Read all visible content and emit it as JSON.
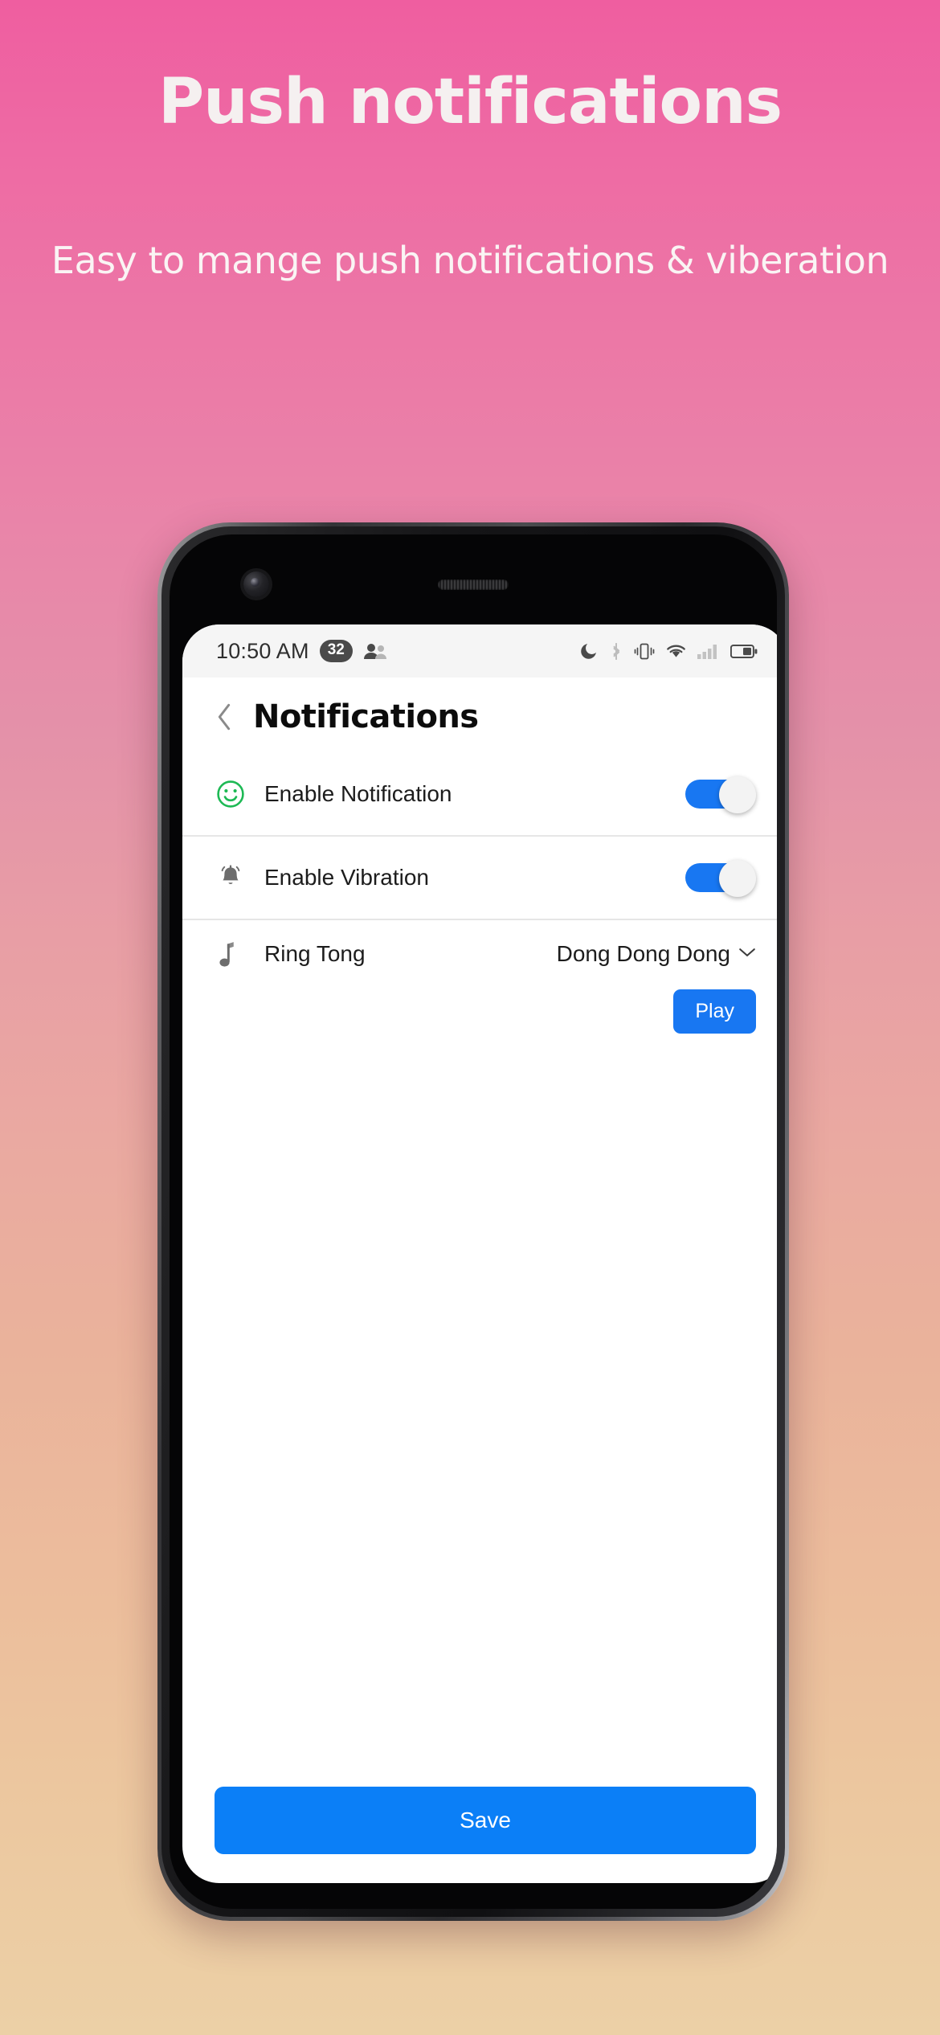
{
  "promo": {
    "title": "Push notifications",
    "subtitle": "Easy to mange push notifications & viberation"
  },
  "colors": {
    "accent_blue": "#1877f2",
    "save_blue": "#0b7ff7",
    "smiley_green": "#1db954",
    "bg_top": "#ef5ea0",
    "bg_bottom": "#ecd0a6",
    "volume_button_orange": "#f59a34"
  },
  "phone": {
    "camera": "front-camera",
    "earpiece": "earpiece-speaker",
    "volume_button": "volume-button",
    "power_button": "power-button"
  },
  "statusbar": {
    "time": "10:50 AM",
    "badge": "32",
    "contacts_icon": "contacts-icon",
    "icons": [
      "dnd-moon-icon",
      "bluetooth-icon",
      "vibrate-icon",
      "wifi-icon",
      "signal-icon",
      "battery-icon"
    ]
  },
  "appbar": {
    "back_icon": "back-chevron-icon",
    "title": "Notifications"
  },
  "rows": [
    {
      "icon": "smiley-face-icon",
      "label": "Enable Notification",
      "control": "toggle",
      "state": "on"
    },
    {
      "icon": "bell-ringing-icon",
      "label": "Enable Vibration",
      "control": "toggle",
      "state": "on"
    },
    {
      "icon": "music-note-icon",
      "label": "Ring Tong",
      "control": "dropdown",
      "value": "Dong Dong Dong",
      "chevron": "chevron-down-icon",
      "action_label": "Play"
    }
  ],
  "footer": {
    "save_label": "Save"
  }
}
